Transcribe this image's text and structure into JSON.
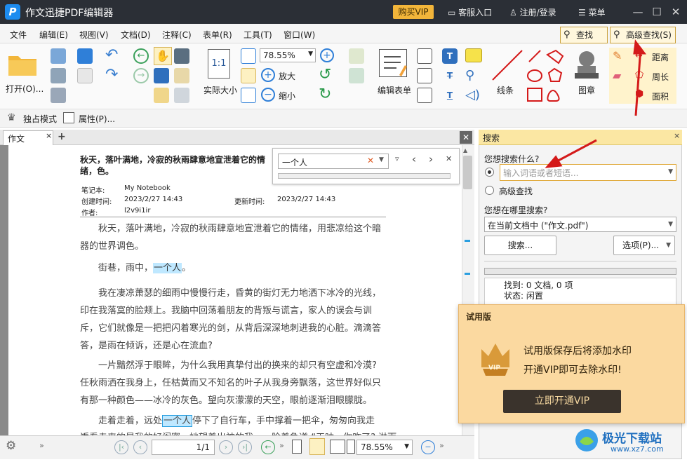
{
  "titlebar": {
    "logo_letter": "P",
    "app_title": "作文迅捷PDF编辑器",
    "vip_button": "购买VIP",
    "customer_service": "客服入口",
    "login": "注册/登录",
    "menu": "菜单"
  },
  "menubar": {
    "items": [
      "文件",
      "编辑(E)",
      "视图(V)",
      "文档(D)",
      "注释(C)",
      "表单(R)",
      "工具(T)",
      "窗口(W)"
    ],
    "find": "查找(F)",
    "advanced_find": "高级查找(S)"
  },
  "toolbar": {
    "open_label": "打开(O)...",
    "zoom_value": "78.55%",
    "actual_size": "实际大小",
    "zoom_in": "放大",
    "zoom_out": "缩小",
    "edit_form": "编辑表单",
    "line": "线条",
    "stamp": "图章",
    "distance": "距离",
    "perimeter": "周长",
    "area": "面积",
    "actual_size_icon_text": "1:1"
  },
  "subbar": {
    "exclusive_mode": "独占模式",
    "properties": "属性(P)..."
  },
  "doc_tab": {
    "label": "作文"
  },
  "findbar": {
    "query": "一个人"
  },
  "document": {
    "heading": "秋天，落叶满地，冷寂的秋雨肆意地宣泄着它的情绪，色。",
    "meta": {
      "notebook_label": "笔记本:",
      "notebook_value": "My Notebook",
      "created_label": "创建时间:",
      "created_value": "2023/2/27 14:43",
      "updated_label": "更新时间:",
      "updated_value": "2023/2/27 14:43",
      "author_label": "作者:",
      "author_value": "l2v9i1ir"
    },
    "p1": "秋天，落叶满地，冷寂的秋雨肆意地宣泄着它的情绪，用悲凉给这个暗器的世界调色。",
    "p2_before": "街巷，雨中，",
    "p2_highlight": "一个人",
    "p2_after": "。",
    "p3": "我在凄凉萧瑟的细雨中慢慢行走，昏黄的街灯无力地洒下冰冷的光线，印在我落寞的脸颊上。我脑中回荡着朋友的背叛与谎言，家人的误会与训斥，它们就像是一把把闪着寒光的剑，从背后深深地刺进我的心脏。滴滴答答，是雨在倾诉，还是心在流血?",
    "p4": "一片黯然浮于眼眸，为什么我用真挚付出的换来的却只有空虚和冷漠? 任秋雨洒在我身上，任枯黄而又不知名的叶子从我身旁飘落，这世界好似只有那一种颜色——冰冷的灰色。望向灰濛濛的天空，眼前逐渐泪眼朦胧。",
    "p5_before": "走着走着，远处",
    "p5_highlight": "一个人",
    "p5_after": "停下了自行车，手中撑着一把伞，匆匆向我走来。",
    "p6": "近看走来的是我的好闺蜜，她望着出神的我，一脸着急道:“天呐，你咋了? 淋雨"
  },
  "statusbar": {
    "page": "1",
    "page_total": "/1",
    "zoom": "78.55%"
  },
  "search_panel": {
    "title": "搜索",
    "what_label": "您想搜索什么?",
    "input_placeholder": "输入词语或者短语...",
    "advanced": "高级查找",
    "where_label": "您想在哪里搜索?",
    "where_value": "在当前文档中 (\"作文.pdf\")",
    "search_button": "搜索...",
    "options_button": "选项(P)...",
    "found": "找到: 0 文档, 0 项",
    "status": "状态: 闲置"
  },
  "trial": {
    "title": "试用版",
    "line1": "试用版保存后将添加水印",
    "line2": "开通VIP即可去除水印!",
    "button": "立即开通VIP",
    "badge": "VIP"
  },
  "watermark": {
    "text": "极光下载站",
    "url": "www.xz7.com"
  },
  "colors": {
    "accent": "#2b9fe0",
    "titlebar": "#2b2f36",
    "vip": "#f2b53a",
    "annotation_red": "#d41a1a"
  }
}
